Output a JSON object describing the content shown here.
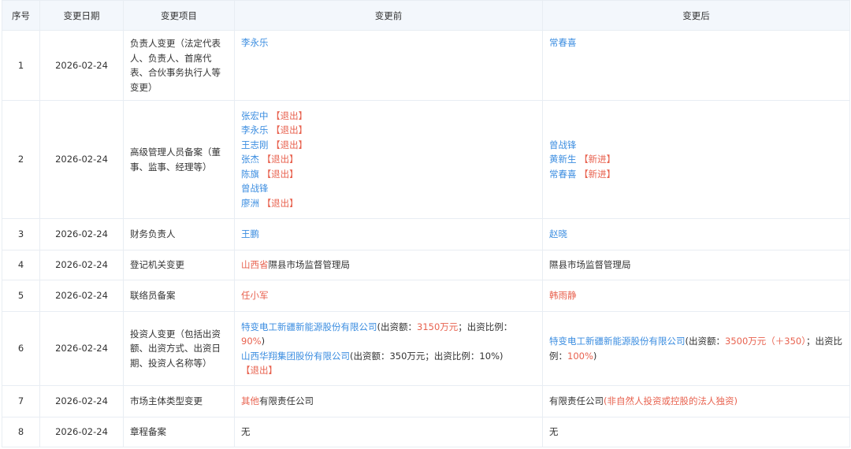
{
  "colors": {
    "blue": "#3b8de0",
    "red": "#e8624f",
    "header_bg": "#f3f7fc"
  },
  "headers": [
    "序号",
    "变更日期",
    "变更项目",
    "变更前",
    "变更后"
  ],
  "rows": [
    {
      "no": "1",
      "date": "2026-02-24",
      "item": "负责人变更（法定代表人、负责人、首席代表、合伙事务执行人等变更）",
      "before": [
        [
          {
            "t": "李永乐",
            "c": "blue"
          }
        ]
      ],
      "after": [
        [
          {
            "t": "常春喜",
            "c": "blue"
          }
        ]
      ]
    },
    {
      "no": "2",
      "date": "2026-02-24",
      "item": "高级管理人员备案（董事、监事、经理等）",
      "before": [
        [
          {
            "t": "张宏中",
            "c": "blue"
          },
          {
            "t": " 【退出】",
            "c": "red"
          }
        ],
        [
          {
            "t": "李永乐",
            "c": "blue"
          },
          {
            "t": " 【退出】",
            "c": "red"
          }
        ],
        [
          {
            "t": "王志刚",
            "c": "blue"
          },
          {
            "t": " 【退出】",
            "c": "red"
          }
        ],
        [
          {
            "t": "张杰",
            "c": "blue"
          },
          {
            "t": " 【退出】",
            "c": "red"
          }
        ],
        [
          {
            "t": "陈旗",
            "c": "blue"
          },
          {
            "t": " 【退出】",
            "c": "red"
          }
        ],
        [
          {
            "t": "曾战锋",
            "c": "blue"
          }
        ],
        [
          {
            "t": "廖洲",
            "c": "blue"
          },
          {
            "t": " 【退出】",
            "c": "red"
          }
        ]
      ],
      "after": [
        [
          {
            "t": "曾战锋",
            "c": "blue"
          }
        ],
        [
          {
            "t": "黄新生",
            "c": "blue"
          },
          {
            "t": " 【新进】",
            "c": "red"
          }
        ],
        [
          {
            "t": "常春喜",
            "c": "blue"
          },
          {
            "t": " 【新进】",
            "c": "red"
          }
        ]
      ]
    },
    {
      "no": "3",
      "date": "2026-02-24",
      "item": "财务负责人",
      "before": [
        [
          {
            "t": "王鹏",
            "c": "blue"
          }
        ]
      ],
      "after": [
        [
          {
            "t": "赵晓",
            "c": "blue"
          }
        ]
      ]
    },
    {
      "no": "4",
      "date": "2026-02-24",
      "item": "登记机关变更",
      "before": [
        [
          {
            "t": "山西省",
            "c": "red"
          },
          {
            "t": "隰县市场监督管理局",
            "c": "plain"
          }
        ]
      ],
      "after": [
        [
          {
            "t": "隰县市场监督管理局",
            "c": "plain"
          }
        ]
      ]
    },
    {
      "no": "5",
      "date": "2026-02-24",
      "item": "联络员备案",
      "before": [
        [
          {
            "t": "任小军",
            "c": "red"
          }
        ]
      ],
      "after": [
        [
          {
            "t": "韩雨静",
            "c": "red"
          }
        ]
      ]
    },
    {
      "no": "6",
      "date": "2026-02-24",
      "item": "投资人变更（包括出资额、出资方式、出资日期、投资人名称等）",
      "before": [
        [
          {
            "t": "特变电工新疆新能源股份有限公司",
            "c": "blue"
          },
          {
            "t": "(出资额：",
            "c": "plain"
          },
          {
            "t": "3150万元",
            "c": "red"
          },
          {
            "t": "；出资比例：",
            "c": "plain"
          },
          {
            "t": "90%",
            "c": "red"
          },
          {
            "t": ")",
            "c": "plain"
          }
        ],
        [
          {
            "t": "山西华翔集团股份有限公司",
            "c": "blue"
          },
          {
            "t": "(出资额：350万元；出资比例：10%)",
            "c": "plain"
          }
        ],
        [
          {
            "t": "【退出】",
            "c": "red"
          }
        ]
      ],
      "after": [
        [
          {
            "t": "特变电工新疆新能源股份有限公司",
            "c": "blue"
          },
          {
            "t": "(出资额：",
            "c": "plain"
          },
          {
            "t": "3500万元（＋350）",
            "c": "red"
          },
          {
            "t": "；出资比例：",
            "c": "plain"
          },
          {
            "t": "100%",
            "c": "red"
          },
          {
            "t": ")",
            "c": "plain"
          }
        ]
      ]
    },
    {
      "no": "7",
      "date": "2026-02-24",
      "item": "市场主体类型变更",
      "before": [
        [
          {
            "t": "其他",
            "c": "red"
          },
          {
            "t": "有限责任公司",
            "c": "plain"
          }
        ]
      ],
      "after": [
        [
          {
            "t": "有限责任公司",
            "c": "plain"
          },
          {
            "t": "(非自然人投资或控股的法人独资)",
            "c": "red"
          }
        ]
      ]
    },
    {
      "no": "8",
      "date": "2026-02-24",
      "item": "章程备案",
      "before": [
        [
          {
            "t": "无",
            "c": "plain"
          }
        ]
      ],
      "after": [
        [
          {
            "t": "无",
            "c": "plain"
          }
        ]
      ]
    }
  ]
}
